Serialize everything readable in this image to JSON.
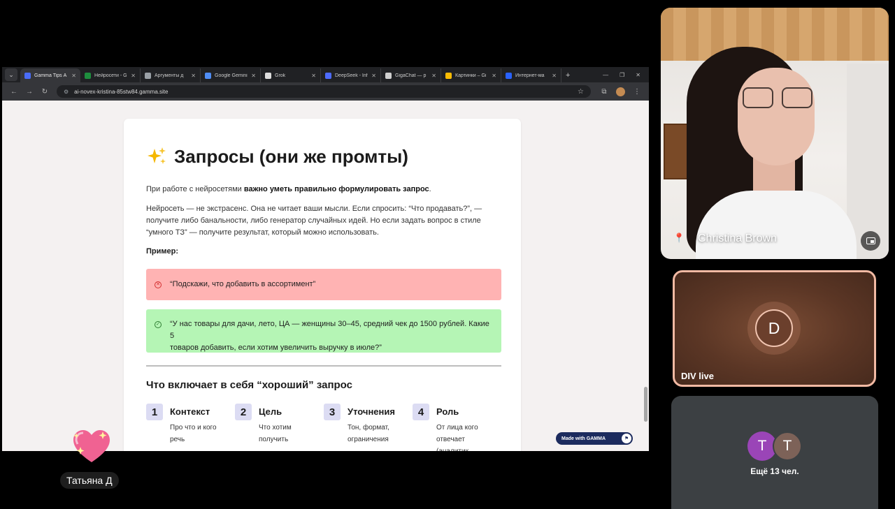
{
  "browser": {
    "tabs": [
      {
        "title": "Gamma Tips А",
        "favicon": "gamma",
        "color": "#4a6cf7",
        "active": true
      },
      {
        "title": "Нейросети - G",
        "favicon": "sheets",
        "color": "#1e8e3e",
        "active": false
      },
      {
        "title": "Аргументы д",
        "favicon": "globe",
        "color": "#9aa0a6",
        "active": false
      },
      {
        "title": "Google Gemini",
        "favicon": "gemini",
        "color": "#4f8df5",
        "active": false
      },
      {
        "title": "Grok",
        "favicon": "grok",
        "color": "#dddddd",
        "active": false
      },
      {
        "title": "DeepSeek - Inf",
        "favicon": "deepseek",
        "color": "#4d6bfe",
        "active": false
      },
      {
        "title": "GigaChat — р",
        "favicon": "gigachat",
        "color": "#cfcfcf",
        "active": false
      },
      {
        "title": "Картинки – Gi",
        "favicon": "chrome",
        "color": "#fbbc04",
        "active": false
      },
      {
        "title": "Интернет-ма",
        "favicon": "v-logo",
        "color": "#2962ff",
        "active": false
      }
    ],
    "url": "ai-novex-kristina-85stw84.gamma.site"
  },
  "slide": {
    "title": "Запросы (они же промты)",
    "intro_plain": "При работе с нейросетями ",
    "intro_bold": "важно уметь правильно формулировать запрос",
    "intro_end": ".",
    "paragraph_lines": [
      "Нейросеть — не экстрасенс. Она не читает ваши мысли. Если спросить: “Что продавать?”, —",
      "получите либо банальности, либо генератор случайных идей. Но если задать вопрос в стиле",
      "“умного ТЗ” — получите результат, который можно использовать."
    ],
    "example_label": "Пример:",
    "bad_example": "“Подскажи, что добавить в ассортимент”",
    "good_example_lines": [
      "“У нас товары для дачи, лето, ЦА — женщины 30–45, средний чек до 1500 рублей. Какие 5",
      "товаров добавить, если хотим увеличить выручку в июле?”"
    ],
    "section_title": "Что включает в себя “хороший” запрос",
    "items": [
      {
        "num": "1",
        "title": "Контекст",
        "lines": [
          "Про что и кого",
          "речь"
        ]
      },
      {
        "num": "2",
        "title": "Цель",
        "lines": [
          "Что хотим",
          "получить"
        ]
      },
      {
        "num": "3",
        "title": "Уточнения",
        "lines": [
          "Тон, формат,",
          "ограничения"
        ]
      },
      {
        "num": "4",
        "title": "Роль",
        "lines": [
          "От лица кого",
          "отвечает",
          "(аналитик,"
        ]
      }
    ],
    "made_with": "Made with GAMMA"
  },
  "participants": {
    "main_name": "Christina Brown",
    "div_name": "DIV live",
    "div_initial": "D",
    "more_initials": [
      "T",
      "T"
    ],
    "more_label": "Ещё 13 чел.",
    "presenter_name": "Татьяна Д"
  }
}
